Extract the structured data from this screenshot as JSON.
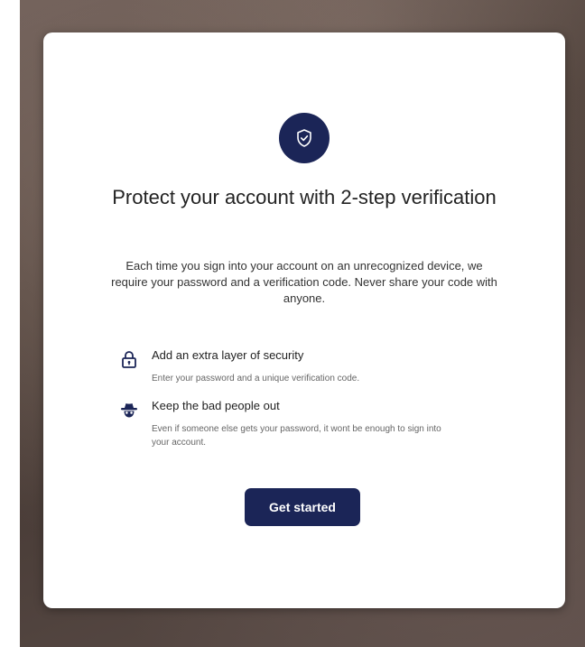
{
  "dialog": {
    "title": "Protect your account with 2-step verification",
    "description": "Each time you sign into your account on an unrecognized device, we require your password and a verification code. Never share your code with anyone.",
    "header_icon": "shield-check-icon",
    "features": [
      {
        "icon": "lock-icon",
        "title": "Add an extra layer of security",
        "description": "Enter your password and a unique verification code."
      },
      {
        "icon": "spy-icon",
        "title": "Keep the bad people out",
        "description": "Even if someone else gets your password, it wont be enough to sign into your account."
      }
    ],
    "cta_label": "Get started"
  },
  "colors": {
    "accent": "#1b2557",
    "card_background": "#ffffff"
  }
}
